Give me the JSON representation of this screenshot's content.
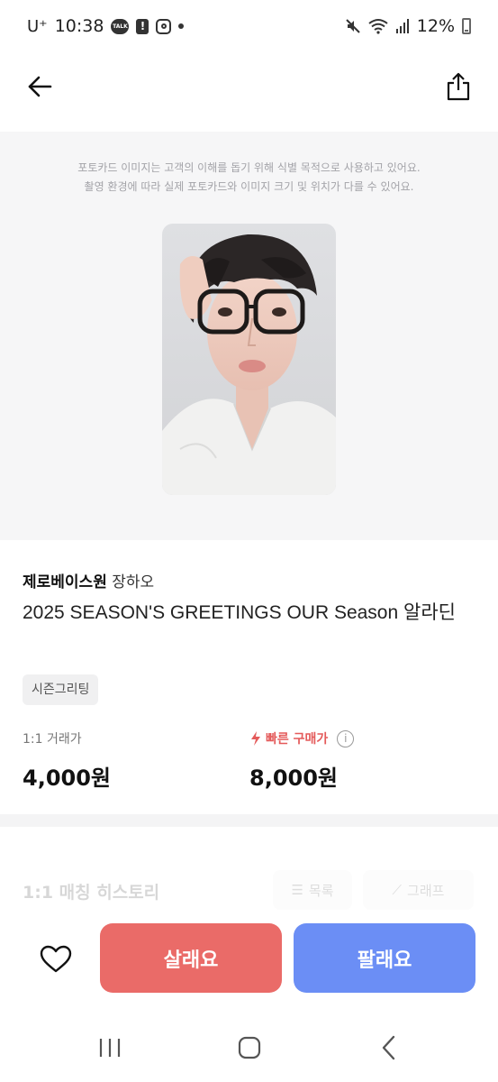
{
  "status_bar": {
    "carrier": "U⁺",
    "time": "10:38",
    "talk_badge": "TALK",
    "battery": "12%"
  },
  "header": {
    "back_icon": "arrow-left-icon",
    "share_icon": "share-icon"
  },
  "image_notice": {
    "line1": "포토카드 이미지는 고객의 이해를 돕기 위해 식별 목적으로 사용하고 있어요.",
    "line2": "촬영 환경에 따라 실제 포토카드와 이미지 크기 및 위치가 다를 수 있어요."
  },
  "product": {
    "group": "제로베이스원",
    "member": "장하오",
    "title": "2025 SEASON'S GREETINGS OUR Season 알라딘",
    "tag": "시즌그리팅"
  },
  "prices": {
    "trade_label": "1:1 거래가",
    "trade_value": "4,000원",
    "quick_label": "빠른 구매가",
    "quick_value": "8,000원"
  },
  "history": {
    "title": "1:1 매칭 히스토리",
    "list_label": "목록",
    "graph_label": "그래프"
  },
  "actions": {
    "buy_label": "살래요",
    "sell_label": "팔래요"
  },
  "colors": {
    "buy": "#ea6b68",
    "sell": "#6b8ef5",
    "quick_accent": "#e45a5a",
    "image_bg": "#f6f6f7"
  }
}
